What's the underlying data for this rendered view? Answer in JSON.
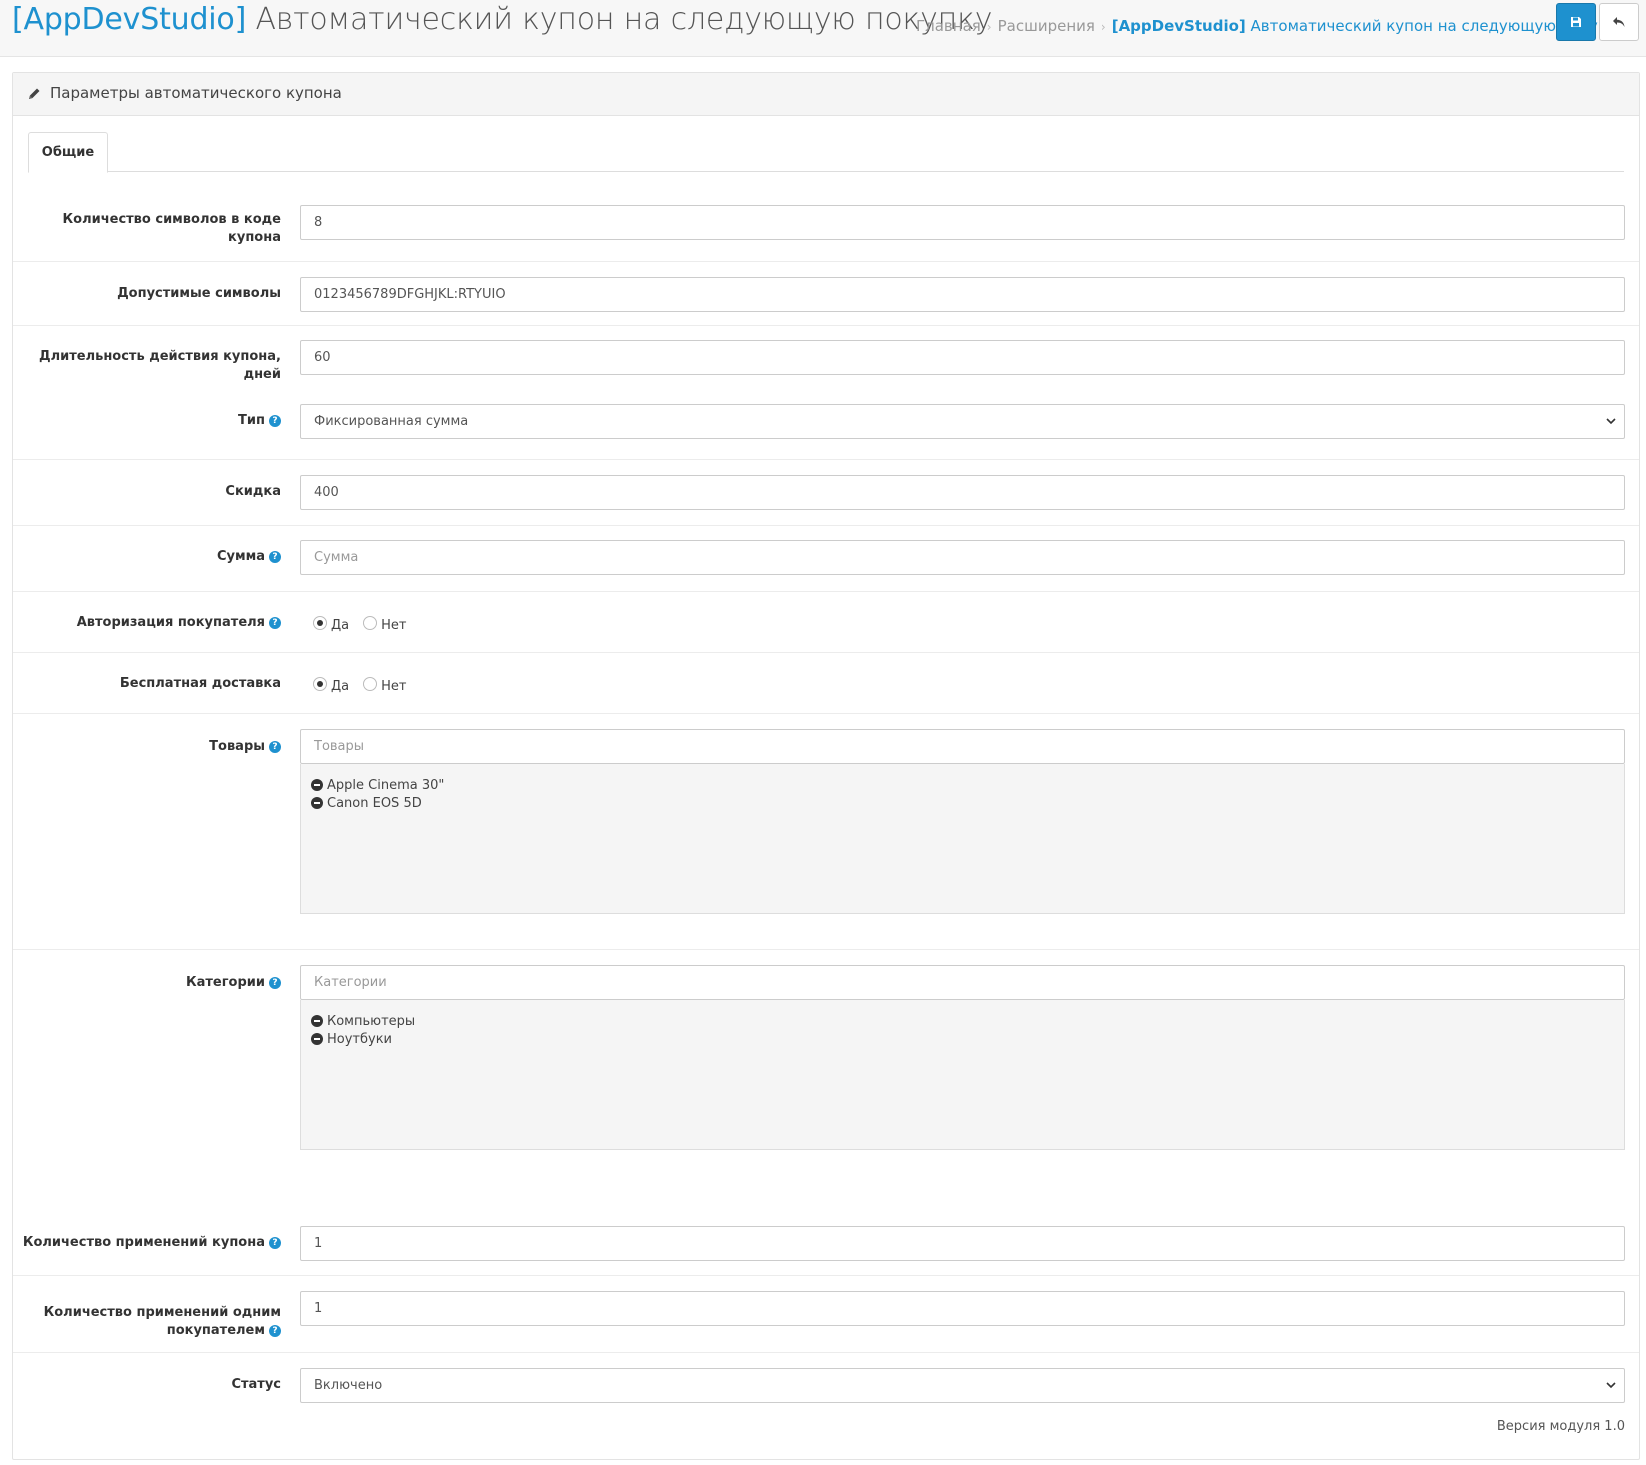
{
  "header": {
    "title_brand": "[AppDevStudio]",
    "title_rest": "Автоматический купон на следующую покупку",
    "breadcrumb": {
      "home": "Главная",
      "extensions": "Расширения",
      "current_brand": "[AppDevStudio]",
      "current_rest": "Автоматический купон на следующую покупку"
    },
    "buttons": {
      "save_icon": "save-icon",
      "back_icon": "reply-icon"
    },
    "colors": {
      "accent": "#1e91cf"
    }
  },
  "panel": {
    "title": "Параметры автоматического купона",
    "tabs": [
      "Общие"
    ]
  },
  "form": {
    "code_length": {
      "label_line1": "Количество символов в коде",
      "label_line2": "купона",
      "value": "8"
    },
    "allowed_chars": {
      "label": "Допустимые символы",
      "value": "0123456789DFGHJKL:RTYUIO"
    },
    "duration": {
      "label_line1": "Длительность действия купона,",
      "label_line2": "дней",
      "value": "60"
    },
    "type": {
      "label": "Тип",
      "selected": "Фиксированная сумма"
    },
    "discount": {
      "label": "Скидка",
      "value": "400"
    },
    "total": {
      "label": "Сумма",
      "placeholder": "Сумма"
    },
    "customer_login": {
      "label": "Авторизация покупателя",
      "options": [
        "Да",
        "Нет"
      ],
      "selected": "Да"
    },
    "free_shipping": {
      "label": "Бесплатная доставка",
      "options": [
        "Да",
        "Нет"
      ],
      "selected": "Да"
    },
    "products": {
      "label": "Товары",
      "placeholder": "Товары",
      "items": [
        "Apple Cinema 30\"",
        "Canon EOS 5D"
      ]
    },
    "categories": {
      "label": "Категории",
      "placeholder": "Категории",
      "items": [
        "Компьютеры",
        "Ноутбуки"
      ]
    },
    "uses_total": {
      "label": "Количество применений купона",
      "value": "1"
    },
    "uses_customer": {
      "label_line1": "Количество применений одним",
      "label_line2": "покупателем",
      "value": "1"
    },
    "status": {
      "label": "Статус",
      "selected": "Включено"
    }
  },
  "footer": {
    "version": "Версия модуля 1.0"
  }
}
